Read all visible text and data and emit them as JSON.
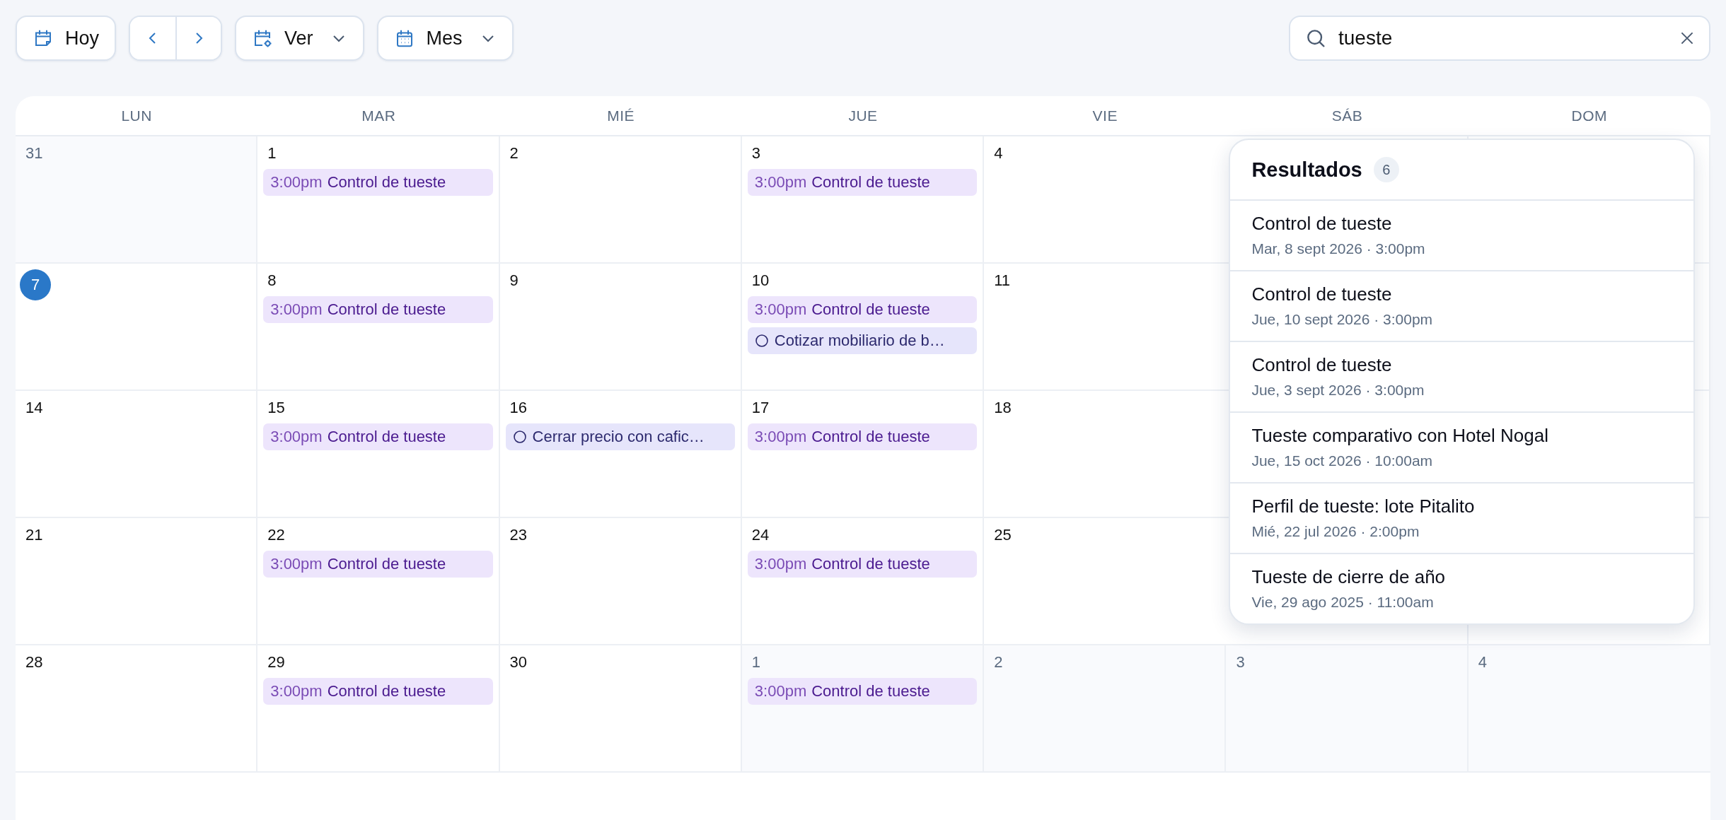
{
  "toolbar": {
    "today_button": {
      "label": "Hoy"
    },
    "view_dropdown": {
      "label": "Ver"
    },
    "range_dropdown": {
      "label": "Mes"
    }
  },
  "search": {
    "value": "tueste"
  },
  "calendar": {
    "weekdays": [
      "LUN",
      "MAR",
      "MIÉ",
      "JUE",
      "VIE",
      "SÁB",
      "DOM"
    ],
    "weeks": [
      [
        {
          "day": "31",
          "outside": true,
          "today": false
        },
        {
          "day": "1",
          "outside": false,
          "today": false,
          "events": [
            {
              "kind": "timed",
              "time": "3:00pm",
              "title": "Control de tueste"
            }
          ]
        },
        {
          "day": "2",
          "outside": false,
          "today": false
        },
        {
          "day": "3",
          "outside": false,
          "today": false,
          "events": [
            {
              "kind": "timed",
              "time": "3:00pm",
              "title": "Control de tueste"
            }
          ]
        },
        {
          "day": "4",
          "outside": false,
          "today": false
        }
      ],
      [
        {
          "day": "7",
          "outside": false,
          "today": true
        },
        {
          "day": "8",
          "outside": false,
          "today": false,
          "events": [
            {
              "kind": "timed",
              "time": "3:00pm",
              "title": "Control de tueste"
            }
          ]
        },
        {
          "day": "9",
          "outside": false,
          "today": false
        },
        {
          "day": "10",
          "outside": false,
          "today": false,
          "events": [
            {
              "kind": "timed",
              "time": "3:00pm",
              "title": "Control de tueste"
            },
            {
              "kind": "task",
              "title": "Cotizar mobiliario de b…"
            }
          ]
        },
        {
          "day": "11",
          "outside": false,
          "today": false
        }
      ],
      [
        {
          "day": "14",
          "outside": false,
          "today": false
        },
        {
          "day": "15",
          "outside": false,
          "today": false,
          "events": [
            {
              "kind": "timed",
              "time": "3:00pm",
              "title": "Control de tueste"
            }
          ]
        },
        {
          "day": "16",
          "outside": false,
          "today": false,
          "events": [
            {
              "kind": "task",
              "title": "Cerrar precio con cafic…"
            }
          ]
        },
        {
          "day": "17",
          "outside": false,
          "today": false,
          "events": [
            {
              "kind": "timed",
              "time": "3:00pm",
              "title": "Control de tueste"
            }
          ]
        },
        {
          "day": "18",
          "outside": false,
          "today": false
        }
      ],
      [
        {
          "day": "21",
          "outside": false,
          "today": false
        },
        {
          "day": "22",
          "outside": false,
          "today": false,
          "events": [
            {
              "kind": "timed",
              "time": "3:00pm",
              "title": "Control de tueste"
            }
          ]
        },
        {
          "day": "23",
          "outside": false,
          "today": false
        },
        {
          "day": "24",
          "outside": false,
          "today": false,
          "events": [
            {
              "kind": "timed",
              "time": "3:00pm",
              "title": "Control de tueste"
            }
          ]
        },
        {
          "day": "25",
          "outside": false,
          "today": false
        }
      ],
      [
        {
          "day": "28",
          "outside": false,
          "today": false
        },
        {
          "day": "29",
          "outside": false,
          "today": false,
          "events": [
            {
              "kind": "timed",
              "time": "3:00pm",
              "title": "Control de tueste"
            }
          ]
        },
        {
          "day": "30",
          "outside": false,
          "today": false
        },
        {
          "day": "1",
          "outside": true,
          "today": false,
          "events": [
            {
              "kind": "timed",
              "time": "3:00pm",
              "title": "Control de tueste"
            }
          ]
        },
        {
          "day": "2",
          "outside": true,
          "today": false
        },
        {
          "day": "3",
          "outside": true,
          "today": false
        },
        {
          "day": "4",
          "outside": true,
          "today": false
        }
      ]
    ]
  },
  "results": {
    "title": "Resultados",
    "count": "6",
    "items": [
      {
        "title": "Control de tueste",
        "date": "Mar, 8 sept 2026 · 3:00pm"
      },
      {
        "title": "Control de tueste",
        "date": "Jue, 10 sept 2026 · 3:00pm"
      },
      {
        "title": "Control de tueste",
        "date": "Jue, 3 sept 2026 · 3:00pm"
      },
      {
        "title": "Tueste comparativo con Hotel Nogal",
        "date": "Jue, 15 oct 2026 · 10:00am"
      },
      {
        "title": "Perfil de tueste: lote Pitalito",
        "date": "Mié, 22 jul 2026 · 2:00pm"
      },
      {
        "title": "Tueste de cierre de año",
        "date": "Vie, 29 ago 2025 · 11:00am"
      }
    ]
  }
}
